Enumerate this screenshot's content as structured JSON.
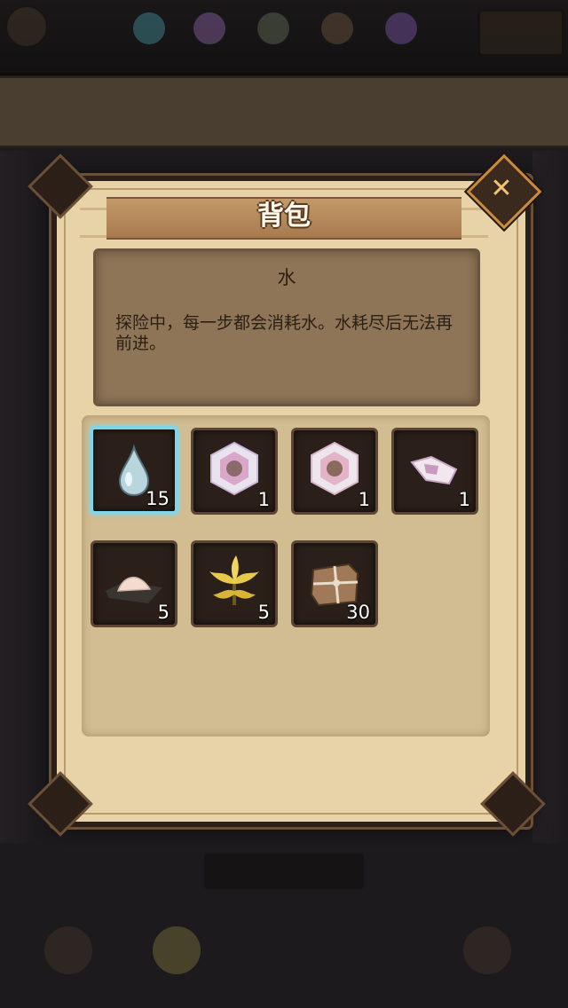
{
  "dialog": {
    "title": "背包",
    "close_icon": "close-icon"
  },
  "description": {
    "item_name": "水",
    "text": "探险中，每一步都会消耗水。水耗尽后无法再前进。"
  },
  "inventory": {
    "slots": [
      {
        "icon": "water-drop-icon",
        "count": "15",
        "selected": true
      },
      {
        "icon": "purple-crystal-gem-icon",
        "count": "1"
      },
      {
        "icon": "pink-crystal-gem-icon",
        "count": "1"
      },
      {
        "icon": "crystal-shard-icon",
        "count": "1"
      },
      {
        "icon": "salt-pile-icon",
        "count": "5"
      },
      {
        "icon": "yellow-herb-icon",
        "count": "5"
      },
      {
        "icon": "parcel-box-icon",
        "count": "30"
      }
    ]
  },
  "colors": {
    "panel": "#e7d3a7",
    "slot_selected_border": "#7fd6ea",
    "title_text": "#fff8ea"
  }
}
